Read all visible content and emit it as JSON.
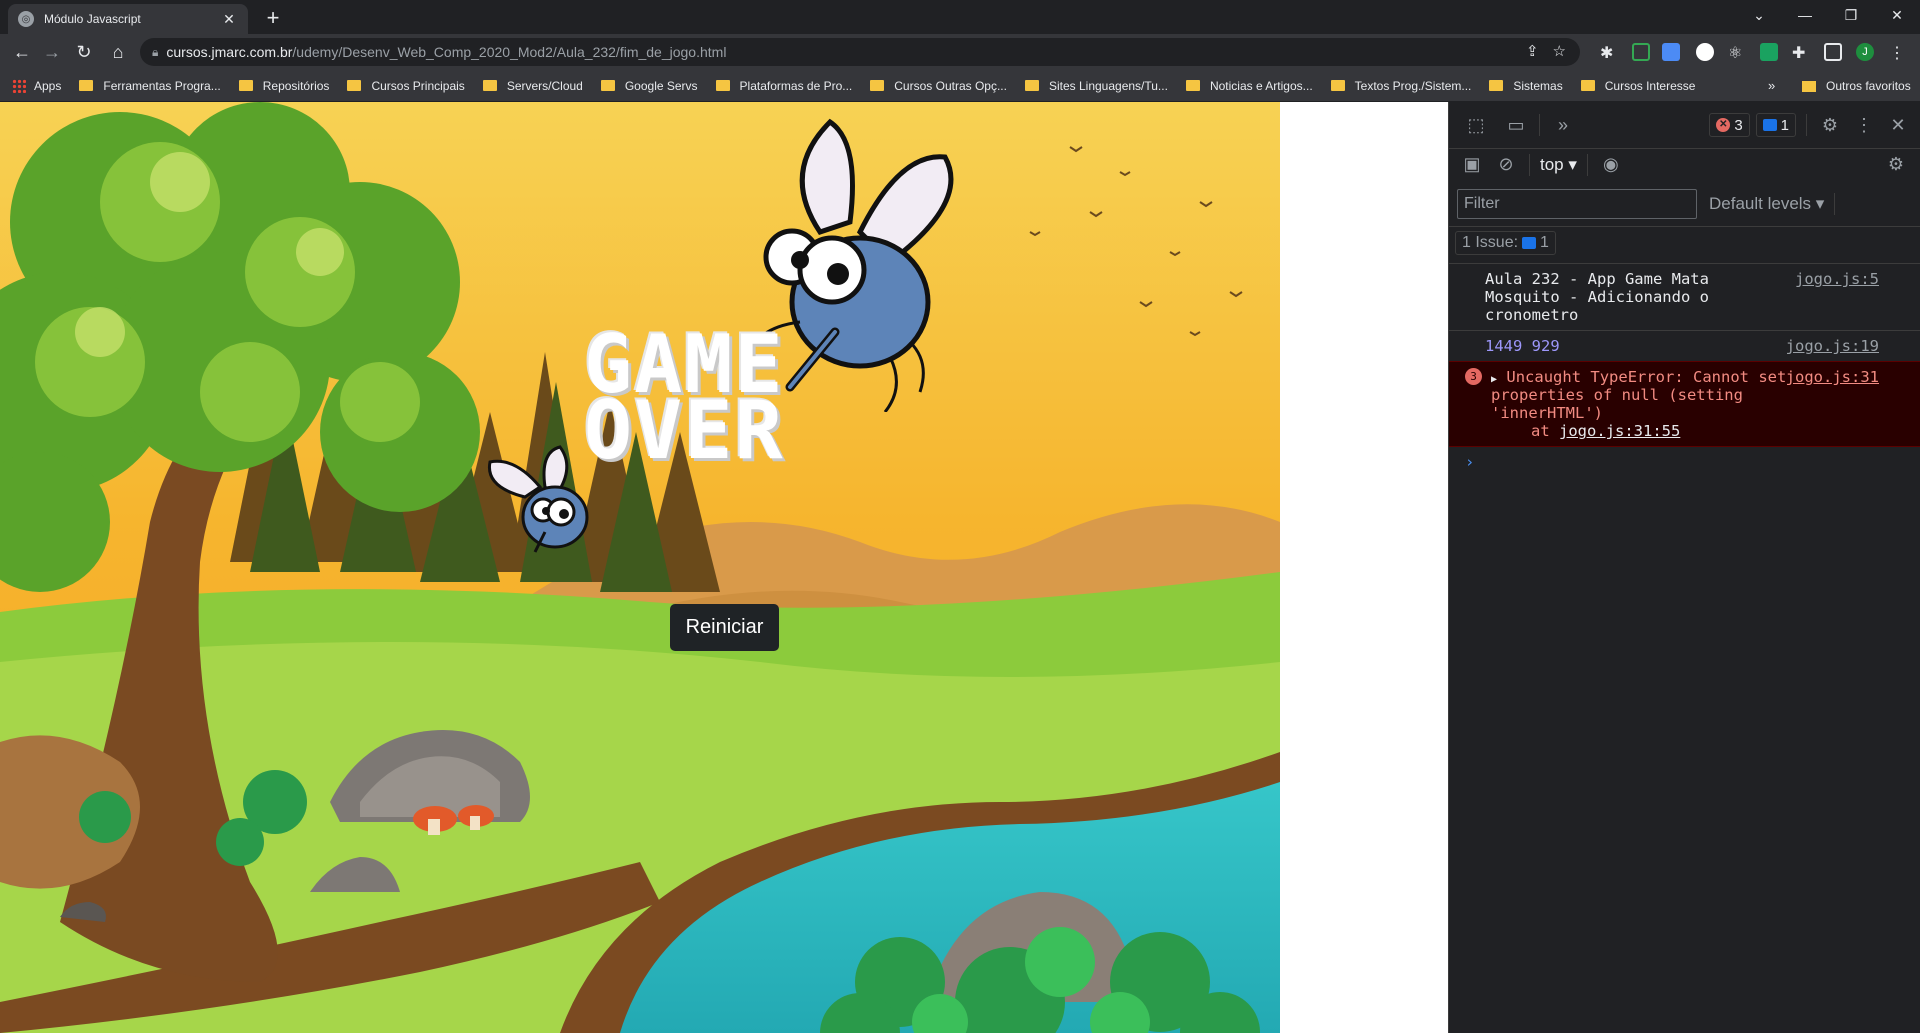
{
  "browser": {
    "tab_title": "Módulo Javascript",
    "url_host": "cursos.jmarc.com.br",
    "url_path": "/udemy/Desenv_Web_Comp_2020_Mod2/Aula_232/fim_de_jogo.html",
    "bookmarks": [
      "Apps",
      "Ferramentas Progra...",
      "Repositórios",
      "Cursos Principais",
      "Servers/Cloud",
      "Google Servs",
      "Plataformas de Pro...",
      "Cursos Outras Opç...",
      "Sites Linguagens/Tu...",
      "Noticias e Artigos...",
      "Textos Prog./Sistem...",
      "Sistemas",
      "Cursos Interesse"
    ],
    "bookmarks_more": "»",
    "other_bookmarks": "Outros favoritos",
    "profile_initial": "J"
  },
  "game": {
    "title_line1": "GAME",
    "title_line2": "OVER",
    "restart_label": "Reiniciar"
  },
  "devtools": {
    "error_count": "3",
    "message_count": "1",
    "context": "top",
    "filter_placeholder": "Filter",
    "levels": "Default levels",
    "issues_label": "1 Issue:",
    "issues_count": "1",
    "logs": [
      {
        "text": "Aula 232 - App Game Mata Mosquito - Adicionando o cronometro",
        "source": "jogo.js:5"
      },
      {
        "text": "1449 929",
        "source": "jogo.js:19"
      }
    ],
    "error": {
      "repeat": "3",
      "message": "Uncaught TypeError: Cannot set properties of null (setting 'innerHTML')",
      "stack_prefix": "at ",
      "stack_link": "jogo.js:31:55",
      "source": "jogo.js:31"
    },
    "prompt": "›"
  }
}
